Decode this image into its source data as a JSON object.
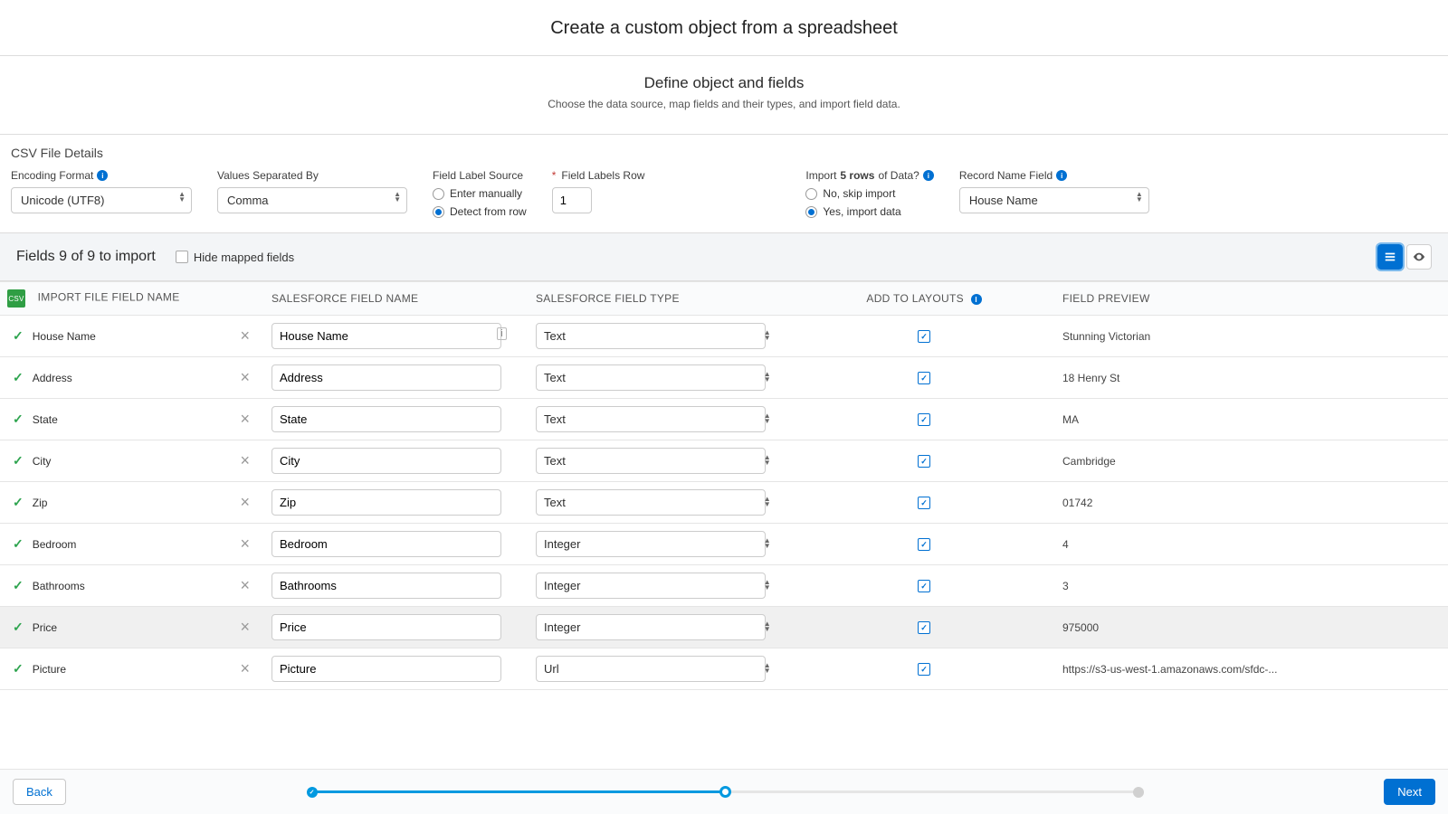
{
  "title": "Create a custom object from a spreadsheet",
  "section": {
    "heading": "Define object and fields",
    "sub": "Choose the data source, map fields and their types, and import field data."
  },
  "csv": {
    "label": "CSV File Details",
    "encoding": {
      "label": "Encoding Format",
      "value": "Unicode (UTF8)"
    },
    "separator": {
      "label": "Values Separated By",
      "value": "Comma"
    },
    "fieldLabelSource": {
      "label": "Field Label Source",
      "options": [
        "Enter manually",
        "Detect from row"
      ],
      "selected": 1
    },
    "labelsRow": {
      "label": "Field Labels Row",
      "value": "1"
    },
    "importData": {
      "label_pre": "Import ",
      "label_bold": "5 rows",
      "label_post": " of Data?",
      "options": [
        "No, skip import",
        "Yes, import data"
      ],
      "selected": 1
    },
    "recordName": {
      "label": "Record Name Field",
      "value": "House Name"
    }
  },
  "fieldsBar": {
    "title": "Fields 9 of 9 to import",
    "hide": "Hide mapped fields"
  },
  "columns": {
    "import": "IMPORT FILE FIELD NAME",
    "sfname": "SALESFORCE FIELD NAME",
    "sftype": "SALESFORCE FIELD TYPE",
    "layouts": "ADD TO LAYOUTS",
    "preview": "FIELD PREVIEW"
  },
  "rows": [
    {
      "file": "House Name",
      "name": "House Name",
      "type": "Text",
      "layout": true,
      "preview": "Stunning Victorian",
      "suffix": true
    },
    {
      "file": "Address",
      "name": "Address",
      "type": "Text",
      "layout": true,
      "preview": "18 Henry St"
    },
    {
      "file": "State",
      "name": "State",
      "type": "Text",
      "layout": true,
      "preview": "MA"
    },
    {
      "file": "City",
      "name": "City",
      "type": "Text",
      "layout": true,
      "preview": "Cambridge"
    },
    {
      "file": "Zip",
      "name": "Zip",
      "type": "Text",
      "layout": true,
      "preview": "01742"
    },
    {
      "file": "Bedroom",
      "name": "Bedroom",
      "type": "Integer",
      "layout": true,
      "preview": "4"
    },
    {
      "file": "Bathrooms",
      "name": "Bathrooms",
      "type": "Integer",
      "layout": true,
      "preview": "3"
    },
    {
      "file": "Price",
      "name": "Price",
      "type": "Integer",
      "layout": true,
      "preview": "975000",
      "highlight": true
    },
    {
      "file": "Picture",
      "name": "Picture",
      "type": "Url",
      "layout": true,
      "preview": "https://s3-us-west-1.amazonaws.com/sfdc-..."
    }
  ],
  "footer": {
    "back": "Back",
    "next": "Next"
  }
}
